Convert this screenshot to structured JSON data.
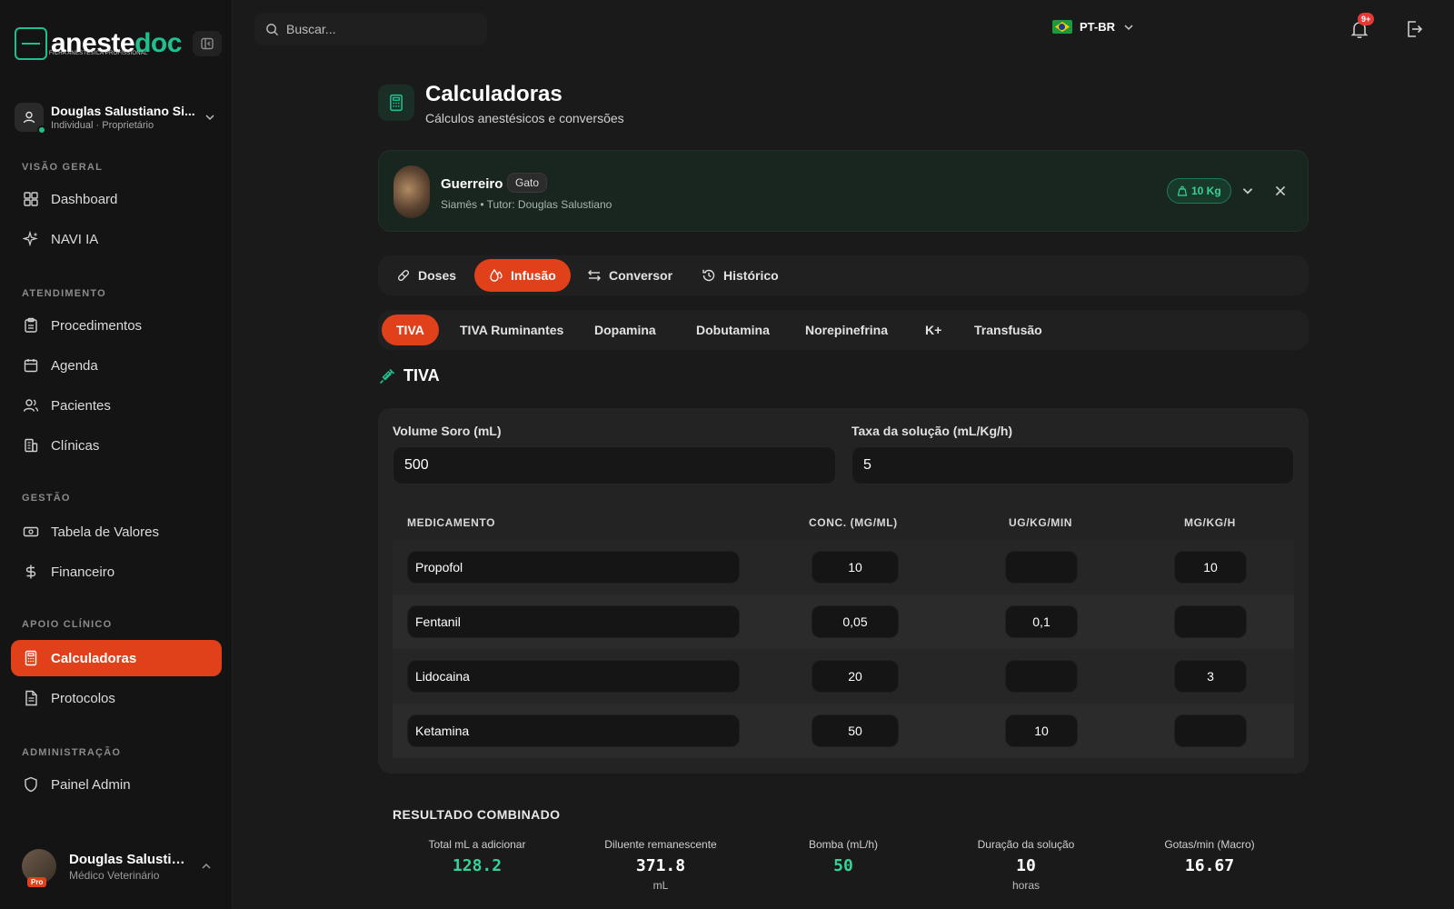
{
  "app": {
    "logo_main": "aneste",
    "logo_accent": "doc",
    "logo_sub": "FICHA ANESTÉSICA PROFISSIONAL"
  },
  "user": {
    "name": "Douglas Salustiano Si...",
    "role": "Individual · Proprietário"
  },
  "sidebar": {
    "sections": [
      {
        "label": "VISÃO GERAL",
        "items": [
          {
            "label": "Dashboard",
            "icon": "grid-icon"
          },
          {
            "label": "NAVI IA",
            "icon": "sparkles-icon"
          }
        ]
      },
      {
        "label": "ATENDIMENTO",
        "items": [
          {
            "label": "Procedimentos",
            "icon": "clipboard-icon"
          },
          {
            "label": "Agenda",
            "icon": "calendar-icon"
          },
          {
            "label": "Pacientes",
            "icon": "users-icon"
          },
          {
            "label": "Clínicas",
            "icon": "building-icon"
          }
        ]
      },
      {
        "label": "GESTÃO",
        "items": [
          {
            "label": "Tabela de Valores",
            "icon": "banknote-icon"
          },
          {
            "label": "Financeiro",
            "icon": "dollar-icon"
          }
        ]
      },
      {
        "label": "APOIO CLÍNICO",
        "items": [
          {
            "label": "Calculadoras",
            "icon": "calculator-icon",
            "active": true
          },
          {
            "label": "Protocolos",
            "icon": "file-icon"
          }
        ]
      },
      {
        "label": "ADMINISTRAÇÃO",
        "items": [
          {
            "label": "Painel Admin",
            "icon": "shield-icon"
          }
        ]
      }
    ]
  },
  "bottom_user": {
    "name": "Douglas Salustia...",
    "role": "Médico Veterinário",
    "badge": "Pro"
  },
  "topbar": {
    "search_placeholder": "Buscar...",
    "language": "PT-BR",
    "notifications": "9+"
  },
  "page": {
    "title": "Calculadoras",
    "subtitle": "Cálculos anestésicos e conversões"
  },
  "patient": {
    "name": "Guerreiro",
    "species": "Gato",
    "details": "Siamês • Tutor: Douglas Salustiano",
    "weight": "10 Kg"
  },
  "main_tabs": [
    {
      "label": "Doses",
      "icon": "pill-icon"
    },
    {
      "label": "Infusão",
      "icon": "droplets-icon",
      "active": true
    },
    {
      "label": "Conversor",
      "icon": "arrows-icon"
    },
    {
      "label": "Histórico",
      "icon": "history-icon"
    }
  ],
  "sub_tabs": [
    {
      "label": "TIVA",
      "active": true
    },
    {
      "label": "TIVA Ruminantes"
    },
    {
      "label": "Dopamina"
    },
    {
      "label": "Dobutamina"
    },
    {
      "label": "Norepinefrina"
    },
    {
      "label": "K+"
    },
    {
      "label": "Transfusão"
    }
  ],
  "section_title": "TIVA",
  "form": {
    "volume_label": "Volume Soro (mL)",
    "volume_value": "500",
    "rate_label": "Taxa da solução (mL/Kg/h)",
    "rate_value": "5"
  },
  "table": {
    "headers": [
      "MEDICAMENTO",
      "CONC. (MG/ML)",
      "UG/KG/MIN",
      "MG/KG/H"
    ],
    "rows": [
      {
        "med": "Propofol",
        "conc": "10",
        "ugkgmin": "",
        "mgkgh": "10"
      },
      {
        "med": "Fentanil",
        "conc": "0,05",
        "ugkgmin": "0,1",
        "mgkgh": ""
      },
      {
        "med": "Lidocaina",
        "conc": "20",
        "ugkgmin": "",
        "mgkgh": "3"
      },
      {
        "med": "Ketamina",
        "conc": "50",
        "ugkgmin": "10",
        "mgkgh": ""
      }
    ]
  },
  "results": {
    "title": "RESULTADO COMBINADO",
    "items": [
      {
        "label": "Total mL a adicionar",
        "value": "128.2",
        "unit": "",
        "color": "#34d399"
      },
      {
        "label": "Diluente remanescente",
        "value": "371.8",
        "unit": "mL",
        "color": "#ffffff"
      },
      {
        "label": "Bomba (mL/h)",
        "value": "50",
        "unit": "",
        "color": "#34d399"
      },
      {
        "label": "Duração da solução",
        "value": "10",
        "unit": "horas",
        "color": "#ffffff"
      },
      {
        "label": "Gotas/min (Macro)",
        "value": "16.67",
        "unit": "",
        "color": "#ffffff"
      }
    ]
  },
  "colors": {
    "accent": "#e0401a",
    "brand": "#1fbf8f",
    "success": "#34d399"
  }
}
